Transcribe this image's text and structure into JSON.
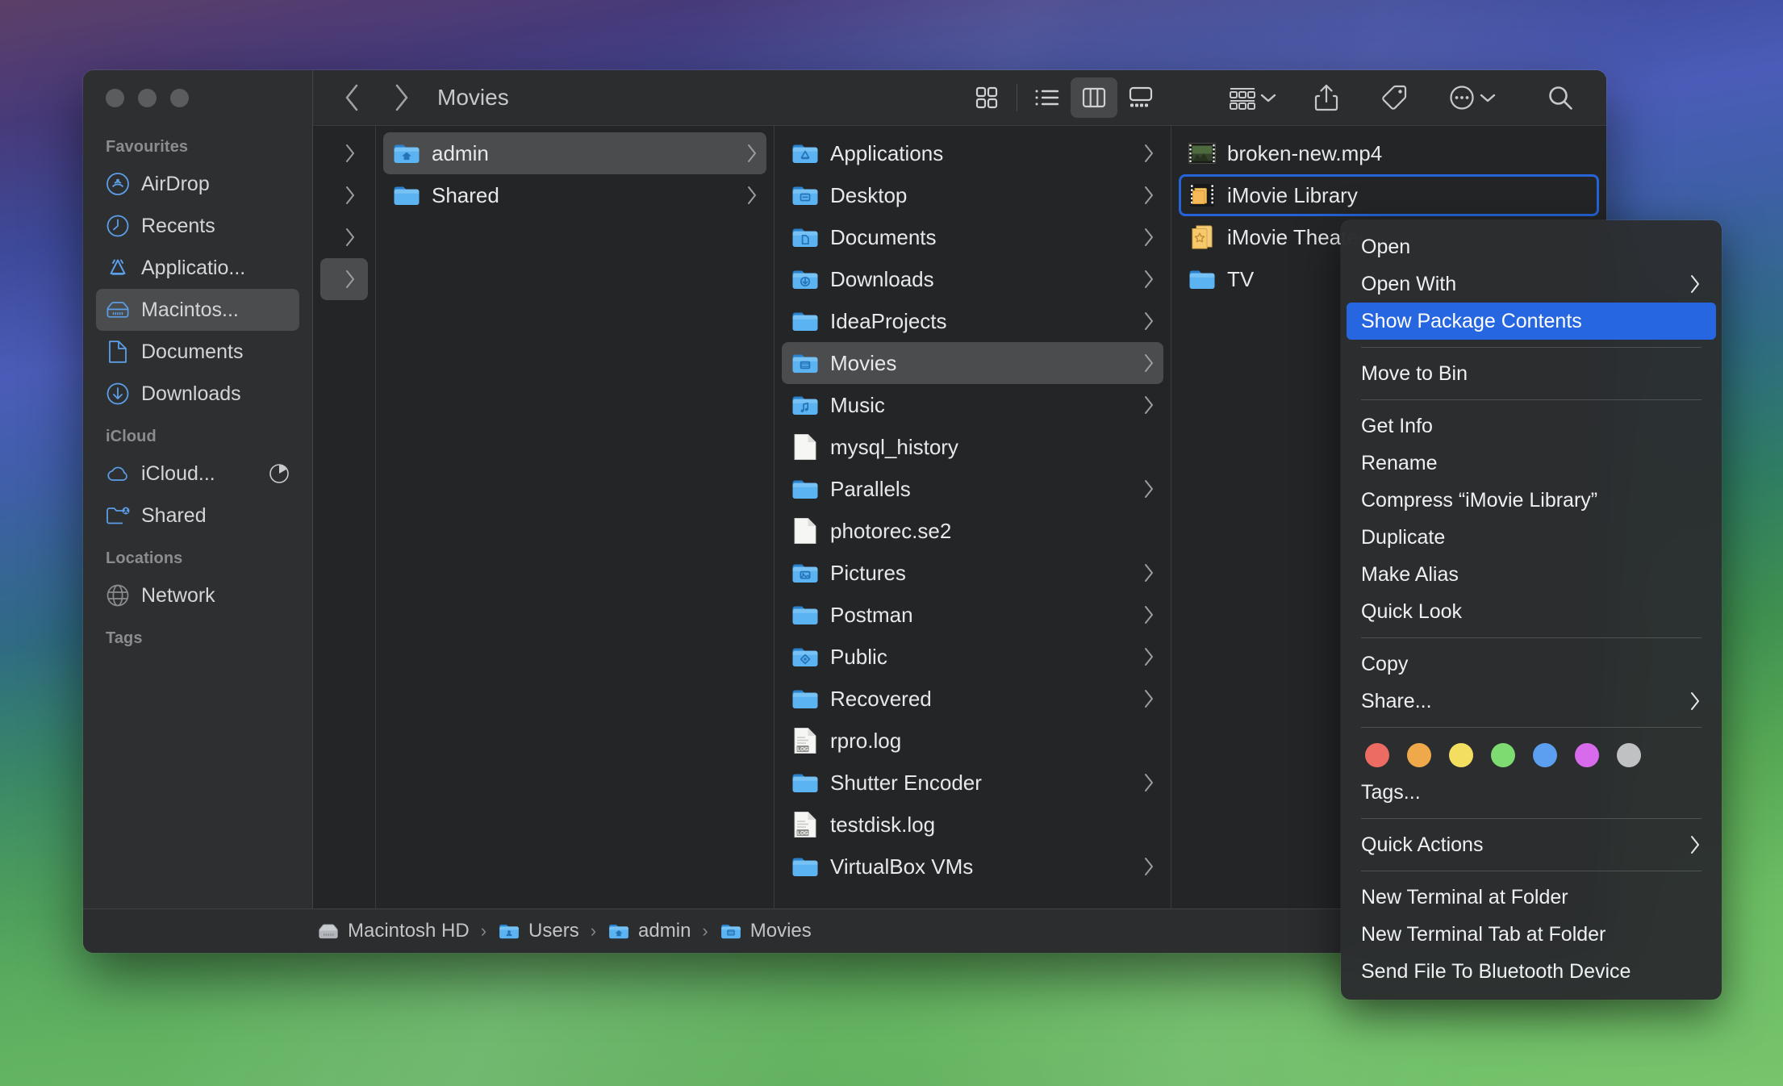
{
  "window": {
    "title": "Movies",
    "traffic_lights": [
      "close",
      "minimize",
      "maximize"
    ]
  },
  "toolbar": {
    "back_icon": "chevron-left-icon",
    "forward_icon": "chevron-right-icon",
    "views": [
      {
        "name": "icon-view",
        "icon": "grid-icon",
        "active": false
      },
      {
        "name": "list-view",
        "icon": "list-icon",
        "active": false
      },
      {
        "name": "column-view",
        "icon": "columns-icon",
        "active": true
      },
      {
        "name": "gallery-view",
        "icon": "gallery-icon",
        "active": false
      }
    ],
    "actions": [
      {
        "name": "group-by-button",
        "icon": "group-icon",
        "chevron": true
      },
      {
        "name": "share-button",
        "icon": "share-icon",
        "chevron": false
      },
      {
        "name": "tags-button",
        "icon": "tag-icon",
        "chevron": false
      },
      {
        "name": "more-button",
        "icon": "ellipsis-circle-icon",
        "chevron": true
      },
      {
        "name": "search-button",
        "icon": "search-icon",
        "chevron": false
      }
    ]
  },
  "sidebar": {
    "sections": [
      {
        "title": "Favourites",
        "items": [
          {
            "label": "AirDrop",
            "icon": "airdrop-icon",
            "selected": false
          },
          {
            "label": "Recents",
            "icon": "clock-icon",
            "selected": false
          },
          {
            "label": "Applicatio...",
            "icon": "applications-icon",
            "selected": false
          },
          {
            "label": "Macintos...",
            "icon": "harddisk-icon",
            "selected": true
          },
          {
            "label": "Documents",
            "icon": "document-icon",
            "selected": false
          },
          {
            "label": "Downloads",
            "icon": "downloads-icon",
            "selected": false
          }
        ]
      },
      {
        "title": "iCloud",
        "items": [
          {
            "label": "iCloud...",
            "icon": "cloud-icon",
            "selected": false,
            "trailing": "progress-pie-icon"
          },
          {
            "label": "Shared",
            "icon": "shared-folder-icon",
            "selected": false
          }
        ]
      },
      {
        "title": "Locations",
        "items": [
          {
            "label": "Network",
            "icon": "globe-icon",
            "selected": false
          }
        ]
      },
      {
        "title": "Tags",
        "items": []
      }
    ]
  },
  "columns": [
    {
      "name": "column-volumes",
      "items": [
        {
          "label": "",
          "icon": "blank",
          "arrow": true,
          "selected": false
        },
        {
          "label": "",
          "icon": "blank",
          "arrow": true,
          "selected": false
        },
        {
          "label": "",
          "icon": "blank",
          "arrow": true,
          "selected": false
        },
        {
          "label": "",
          "icon": "blank",
          "arrow": true,
          "selected": true
        }
      ]
    },
    {
      "name": "column-users",
      "items": [
        {
          "label": "admin",
          "icon": "home-folder-icon",
          "arrow": true,
          "selected": true
        },
        {
          "label": "Shared",
          "icon": "folder-icon",
          "arrow": true,
          "selected": false
        }
      ]
    },
    {
      "name": "column-home",
      "items": [
        {
          "label": "Applications",
          "icon": "applications-folder-icon",
          "arrow": true,
          "selected": false
        },
        {
          "label": "Desktop",
          "icon": "desktop-folder-icon",
          "arrow": true,
          "selected": false
        },
        {
          "label": "Documents",
          "icon": "documents-folder-icon",
          "arrow": true,
          "selected": false
        },
        {
          "label": "Downloads",
          "icon": "downloads-folder-icon",
          "arrow": true,
          "selected": false
        },
        {
          "label": "IdeaProjects",
          "icon": "folder-icon",
          "arrow": true,
          "selected": false
        },
        {
          "label": "Movies",
          "icon": "movies-folder-icon",
          "arrow": true,
          "selected": true
        },
        {
          "label": "Music",
          "icon": "music-folder-icon",
          "arrow": true,
          "selected": false
        },
        {
          "label": "mysql_history",
          "icon": "file-icon",
          "arrow": false,
          "selected": false
        },
        {
          "label": "Parallels",
          "icon": "folder-icon",
          "arrow": true,
          "selected": false
        },
        {
          "label": "photorec.se2",
          "icon": "file-icon",
          "arrow": false,
          "selected": false
        },
        {
          "label": "Pictures",
          "icon": "pictures-folder-icon",
          "arrow": true,
          "selected": false
        },
        {
          "label": "Postman",
          "icon": "folder-icon",
          "arrow": true,
          "selected": false
        },
        {
          "label": "Public",
          "icon": "public-folder-icon",
          "arrow": true,
          "selected": false
        },
        {
          "label": "Recovered",
          "icon": "folder-icon",
          "arrow": true,
          "selected": false
        },
        {
          "label": "rpro.log",
          "icon": "log-file-icon",
          "arrow": false,
          "selected": false
        },
        {
          "label": "Shutter Encoder",
          "icon": "folder-icon",
          "arrow": true,
          "selected": false
        },
        {
          "label": "testdisk.log",
          "icon": "log-file-icon",
          "arrow": false,
          "selected": false
        },
        {
          "label": "VirtualBox VMs",
          "icon": "folder-icon",
          "arrow": true,
          "selected": false
        }
      ]
    },
    {
      "name": "column-movies",
      "items": [
        {
          "label": "broken-new.mp4",
          "icon": "video-file-icon",
          "arrow": false,
          "selected": false
        },
        {
          "label": "iMovie Library",
          "icon": "imovie-library-icon",
          "arrow": false,
          "selected": true
        },
        {
          "label": "iMovie Theater",
          "icon": "imovie-theater-icon",
          "arrow": false,
          "selected": false
        },
        {
          "label": "TV",
          "icon": "folder-icon",
          "arrow": false,
          "selected": false
        }
      ]
    }
  ],
  "pathbar": [
    {
      "label": "Macintosh HD",
      "icon": "harddisk-icon"
    },
    {
      "label": "Users",
      "icon": "users-folder-icon"
    },
    {
      "label": "admin",
      "icon": "home-folder-icon"
    },
    {
      "label": "Movies",
      "icon": "movies-folder-icon"
    }
  ],
  "context_menu": {
    "groups": [
      {
        "items": [
          {
            "label": "Open",
            "submenu": false,
            "highlighted": false
          },
          {
            "label": "Open With",
            "submenu": true,
            "highlighted": false
          },
          {
            "label": "Show Package Contents",
            "submenu": false,
            "highlighted": true
          }
        ]
      },
      {
        "items": [
          {
            "label": "Move to Bin",
            "submenu": false,
            "highlighted": false
          }
        ]
      },
      {
        "items": [
          {
            "label": "Get Info",
            "submenu": false,
            "highlighted": false
          },
          {
            "label": "Rename",
            "submenu": false,
            "highlighted": false
          },
          {
            "label": "Compress “iMovie Library”",
            "submenu": false,
            "highlighted": false
          },
          {
            "label": "Duplicate",
            "submenu": false,
            "highlighted": false
          },
          {
            "label": "Make Alias",
            "submenu": false,
            "highlighted": false
          },
          {
            "label": "Quick Look",
            "submenu": false,
            "highlighted": false
          }
        ]
      },
      {
        "items": [
          {
            "label": "Copy",
            "submenu": false,
            "highlighted": false
          },
          {
            "label": "Share...",
            "submenu": true,
            "highlighted": false
          }
        ]
      }
    ],
    "tag_colors": [
      "#ec6b62",
      "#efa94b",
      "#f3de60",
      "#7ddb71",
      "#5c9ef0",
      "#d86bec",
      "#bfc1c3"
    ],
    "tags_label": "Tags...",
    "quick_actions": {
      "label": "Quick Actions",
      "submenu": true
    },
    "terminal_items": [
      {
        "label": "New Terminal at Folder"
      },
      {
        "label": "New Terminal Tab at Folder"
      },
      {
        "label": "Send File To Bluetooth Device"
      }
    ]
  },
  "colors": {
    "accent": "#2666e0",
    "selection_gray": "#4a4c4d",
    "window_bg": "#232526",
    "chrome_bg": "#2b2d2e",
    "folder_blue": "#5ab0ef"
  }
}
